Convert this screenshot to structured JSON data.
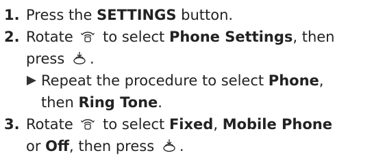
{
  "steps": [
    {
      "number": "1.",
      "parts": [
        "Press the ",
        "SETTINGS",
        " button."
      ]
    },
    {
      "number": "2.",
      "parts": [
        "Rotate ",
        " to select ",
        "Phone Settings",
        ", then",
        "press ",
        "."
      ],
      "note": {
        "parts": [
          "Repeat the procedure to select ",
          "Phone",
          ",",
          "then ",
          "Ring Tone",
          "."
        ]
      }
    },
    {
      "number": "3.",
      "parts": [
        "Rotate ",
        " to select ",
        "Fixed",
        ", ",
        "Mobile Phone",
        "or ",
        "Off",
        ", then press ",
        "."
      ]
    }
  ],
  "icons": {
    "rotate": "interface-dial-rotate-icon",
    "press": "interface-dial-press-icon",
    "note_arrow": "triangle-right-icon"
  },
  "colors": {
    "text": "#222222",
    "arrow": "#333333"
  }
}
